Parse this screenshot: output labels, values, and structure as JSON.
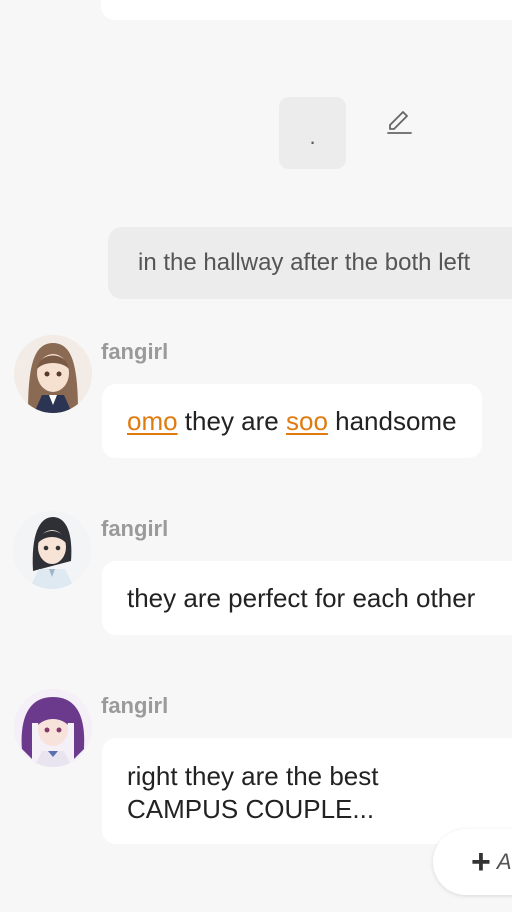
{
  "dot_message": ".",
  "user_message": "in the hallway after the both left",
  "messages": [
    {
      "sender": "fangirl",
      "parts": [
        {
          "text": "omo",
          "highlight": true
        },
        {
          "text": " they are ",
          "highlight": false
        },
        {
          "text": "soo",
          "highlight": true
        },
        {
          "text": " handsome",
          "highlight": false
        }
      ]
    },
    {
      "sender": "fangirl",
      "text": "they are perfect for each other"
    },
    {
      "sender": "fangirl",
      "line1": "right they are the best",
      "line2": "CAMPUS COUPLE..."
    }
  ],
  "add_button": {
    "icon": "plus-icon",
    "label": "A"
  },
  "colors": {
    "highlight": "#e07b10",
    "background": "#f7f7f7",
    "bubble": "#ffffff",
    "user_bubble": "#ececec"
  }
}
